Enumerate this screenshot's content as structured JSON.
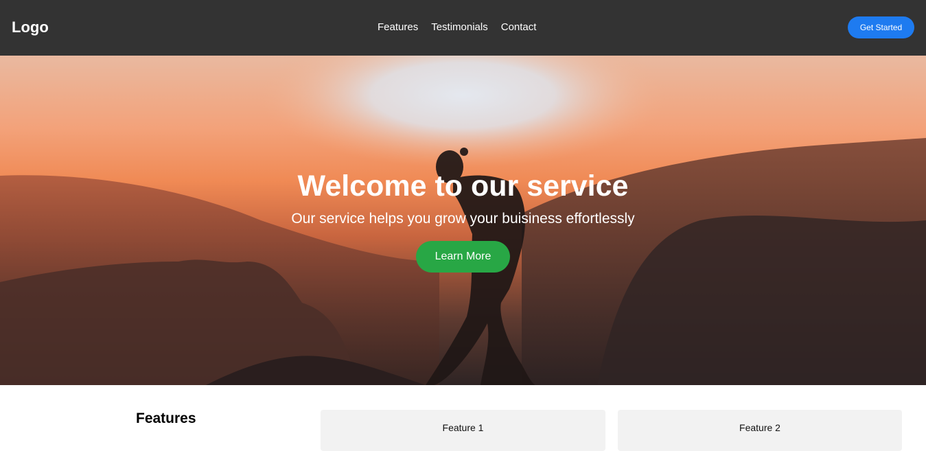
{
  "header": {
    "logo": "Logo",
    "nav": [
      "Features",
      "Testimonials",
      "Contact"
    ],
    "cta_label": "Get Started"
  },
  "hero": {
    "title": "Welcome to our service",
    "subtitle": "Our service helps you grow your buisiness effortlessly",
    "button_label": "Learn More"
  },
  "features": {
    "title": "Features",
    "cards": [
      "Feature 1",
      "Feature 2"
    ]
  },
  "colors": {
    "header_bg": "#333333",
    "cta_blue": "#1e7bf0",
    "learn_green": "#28a745",
    "card_bg": "#f2f2f2"
  }
}
